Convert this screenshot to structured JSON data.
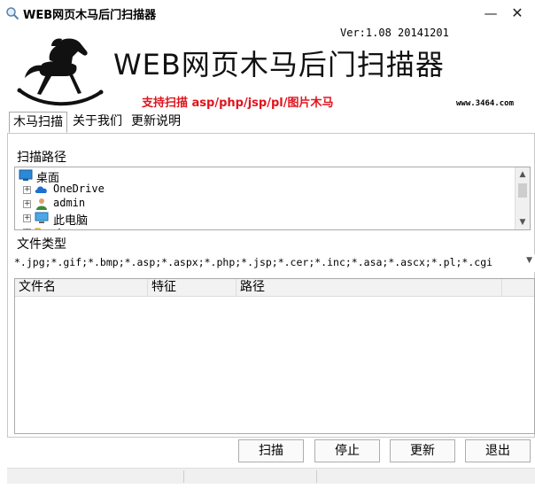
{
  "window": {
    "title": "WEB网页木马后门扫描器",
    "minimize_glyph": "—",
    "close_glyph": "✕"
  },
  "banner": {
    "title": "WEB网页木马后门扫描器",
    "version": "Ver:1.08 20141201",
    "subtitle": "支持扫描 asp/php/jsp/pl/图片木马",
    "url": "www.3464.com",
    "logo": "rocking-horse-logo"
  },
  "tabs": [
    {
      "label": "木马扫描",
      "active": true
    },
    {
      "label": "关于我们",
      "active": false
    },
    {
      "label": "更新说明",
      "active": false
    }
  ],
  "scan_path": {
    "label": "扫描路径",
    "tree": [
      {
        "label": "桌面",
        "icon": "desktop-icon",
        "expandable": false
      },
      {
        "label": "OneDrive",
        "icon": "cloud-icon",
        "expandable": true
      },
      {
        "label": "admin",
        "icon": "user-icon",
        "expandable": true
      },
      {
        "label": "此电脑",
        "icon": "computer-icon",
        "expandable": true
      },
      {
        "label": "库",
        "icon": "folder-icon",
        "expandable": true
      }
    ]
  },
  "file_type": {
    "label": "文件类型",
    "value": "*.jpg;*.gif;*.bmp;*.asp;*.aspx;*.php;*.jsp;*.cer;*.inc;*.asa;*.ascx;*.pl;*.cgi"
  },
  "results_table": {
    "columns": [
      "文件名",
      "特征",
      "路径"
    ],
    "rows": []
  },
  "buttons": {
    "scan": "扫描",
    "stop": "停止",
    "update": "更新",
    "exit": "退出"
  },
  "colors": {
    "subtitle": "#e0141e",
    "onedrive": "#1e6fd0"
  }
}
